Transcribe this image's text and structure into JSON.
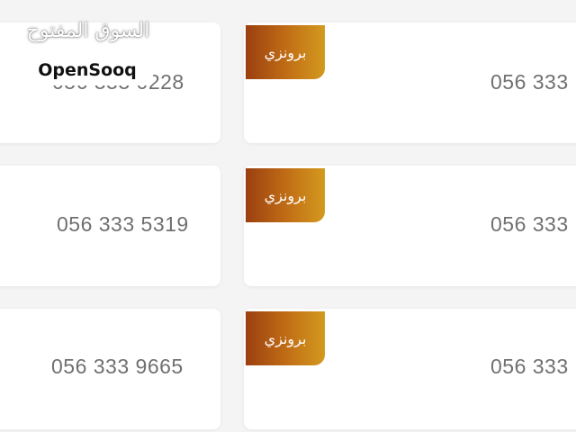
{
  "listings": [
    {
      "left_number": "056 333 0228",
      "right_number": "056 333",
      "badge": "برونزي"
    },
    {
      "left_number": "056 333 5319",
      "right_number": "056 333",
      "badge": "برونزي"
    },
    {
      "left_number": "056 333 9665",
      "right_number": "056 333",
      "badge": "برونزي"
    }
  ],
  "watermark": {
    "arabic": "السوق المفتوح",
    "english": "OpenSooq"
  }
}
